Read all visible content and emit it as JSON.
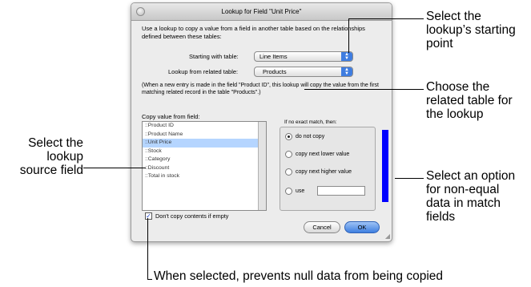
{
  "dialog": {
    "title": "Lookup for Field \"Unit Price\"",
    "intro": "Use a lookup to copy a value from a field in another table based on the relationships defined between these tables:",
    "starting_label": "Starting with table:",
    "starting_value": "Line Items",
    "related_label": "Lookup from related table:",
    "related_value": "Products",
    "note": "(When a new entry is made in the field \"Product ID\", this lookup will copy the value from the first matching related record in the table \"Products\".)",
    "copy_label": "Copy value from field:",
    "fields": [
      "::Product ID",
      "::Product Name",
      "::Unit Price",
      "::Stock",
      "::Category",
      "::Discount",
      "::Total in stock"
    ],
    "selected_field_index": 2,
    "no_match_label": "If no exact match, then:",
    "options": {
      "do_not_copy": "do not copy",
      "copy_lower": "copy next lower value",
      "copy_higher": "copy next higher value",
      "use": "use"
    },
    "selected_option": "do not copy",
    "checkbox_label": "Don't copy contents if empty",
    "checkbox_checked": true,
    "cancel_label": "Cancel",
    "ok_label": "OK"
  },
  "callouts": {
    "starting_point": [
      "Select the",
      "lookup’s starting",
      "point"
    ],
    "related_table": [
      "Choose the",
      "related table for",
      "the lookup"
    ],
    "source_field": [
      "Select the",
      "lookup",
      "source field"
    ],
    "non_equal": [
      "Select an option",
      "for non-equal",
      "data in match",
      "fields"
    ],
    "null_data": "When selected, prevents null data from being copied"
  },
  "colors": {
    "highlight_bar": "#0000ff",
    "selection": "#b5d5ff",
    "ok_button": "#3e7fe0"
  }
}
